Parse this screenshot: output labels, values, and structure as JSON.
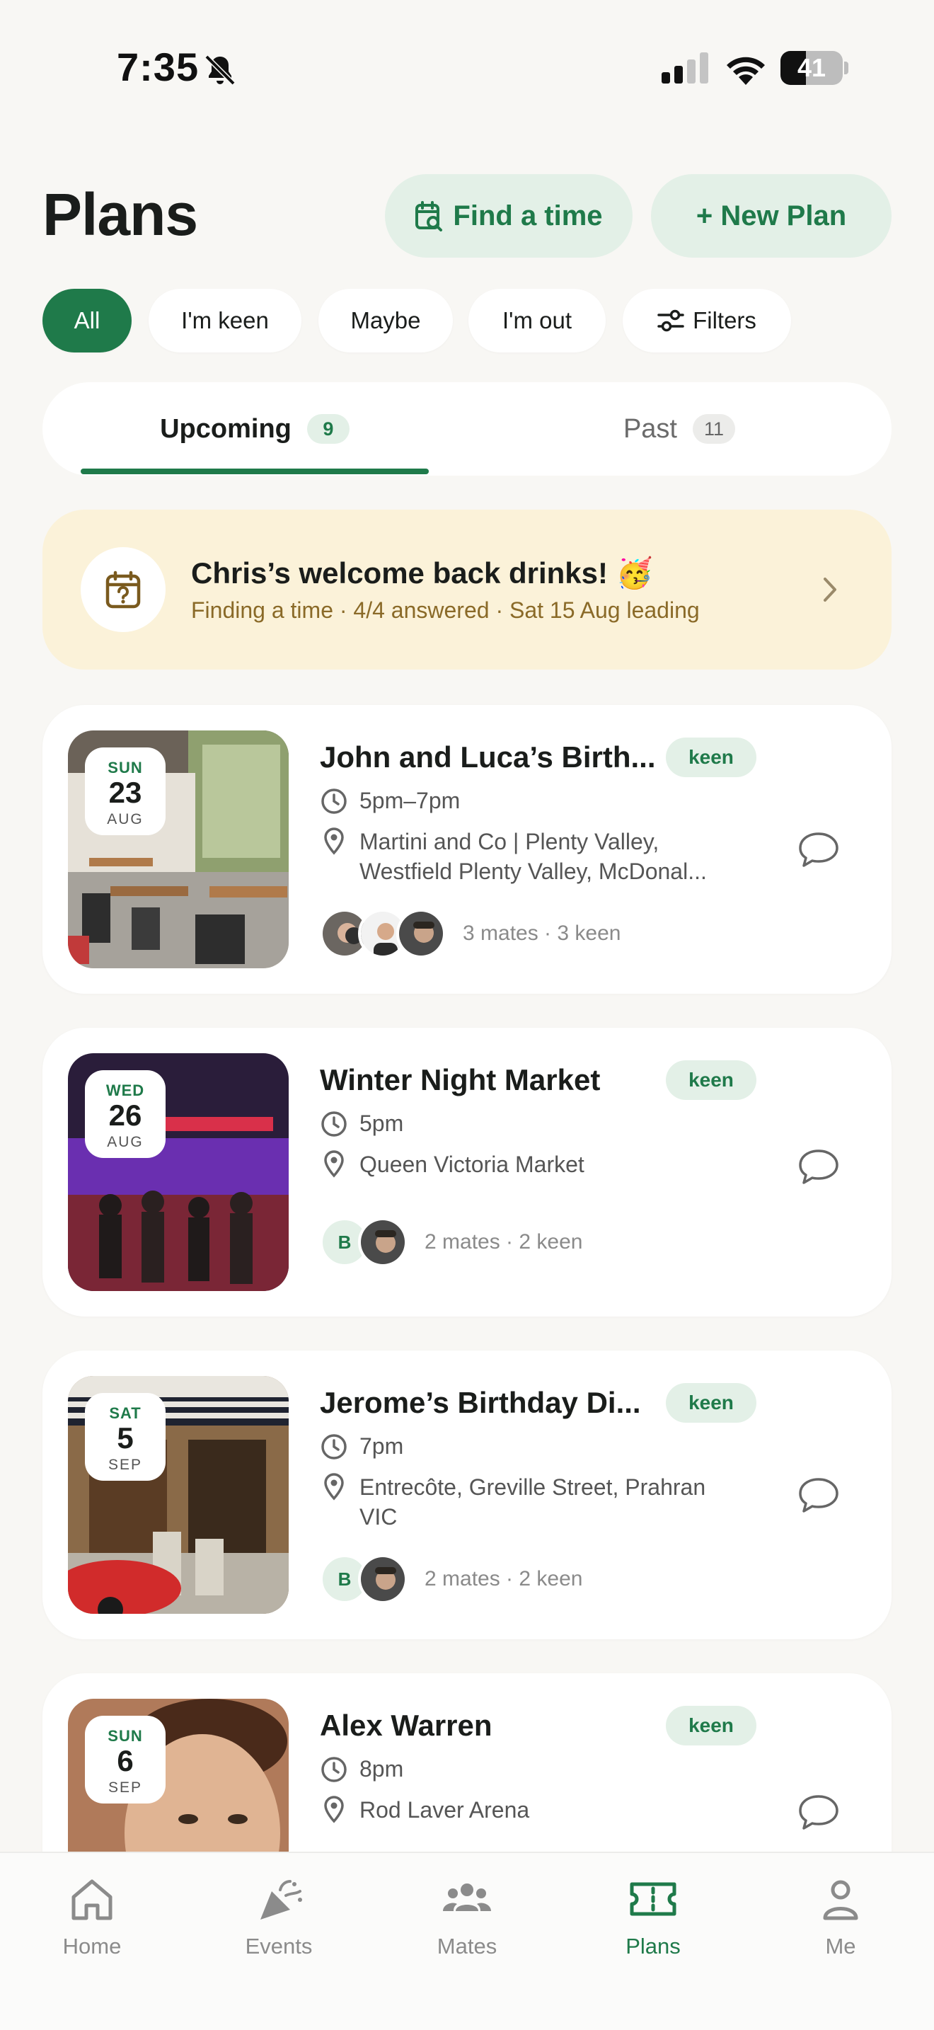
{
  "status": {
    "time": "7:35",
    "battery": "41",
    "battery_level": 0.41
  },
  "header": {
    "title": "Plans",
    "find_time_label": "Find a time",
    "new_plan_label": "+ New Plan"
  },
  "filters": {
    "chips": [
      "All",
      "I'm keen",
      "Maybe",
      "I'm out"
    ],
    "filters_label": "Filters",
    "selected": "All"
  },
  "tabs": {
    "upcoming_label": "Upcoming",
    "upcoming_count": "9",
    "past_label": "Past",
    "past_count": "11",
    "selected": "Upcoming"
  },
  "banner": {
    "title": "Chris’s welcome back drinks! 🥳",
    "subtitle": "Finding a time · 4/4 answered · Sat 15 Aug leading"
  },
  "plans": [
    {
      "dow": "SUN",
      "day": "23",
      "month": "AUG",
      "title": "John and Luca’s Birth...",
      "status": "keen",
      "time": "5pm–7pm",
      "location_line1": "Martini and Co | Plenty Valley,",
      "location_line2": "Westfield Plenty Valley, McDonal...",
      "mates": "3 mates · 3 keen"
    },
    {
      "dow": "WED",
      "day": "26",
      "month": "AUG",
      "title": "Winter Night Market",
      "status": "keen",
      "time": "5pm",
      "location_line1": "Queen Victoria Market",
      "avatar_letter": "B",
      "mates": "2 mates · 2 keen"
    },
    {
      "dow": "SAT",
      "day": "5",
      "month": "SEP",
      "title": "Jerome’s Birthday Di...",
      "status": "keen",
      "time": "7pm",
      "location_line1": "Entrecôte, Greville Street, Prahran",
      "location_line2": "VIC",
      "avatar_letter": "B",
      "mates": "2 mates · 2 keen"
    },
    {
      "dow": "SUN",
      "day": "6",
      "month": "SEP",
      "title": "Alex Warren",
      "status": "keen",
      "time": "8pm",
      "location_line1": "Rod Laver Arena"
    }
  ],
  "nav": {
    "items": [
      {
        "label": "Home",
        "icon": "home-icon"
      },
      {
        "label": "Events",
        "icon": "party-popper-icon"
      },
      {
        "label": "Mates",
        "icon": "people-icon"
      },
      {
        "label": "Plans",
        "icon": "ticket-icon"
      },
      {
        "label": "Me",
        "icon": "person-icon"
      }
    ],
    "active": "Plans"
  },
  "colors": {
    "accent": "#1f7a4a",
    "accent_soft": "#e3f0e7",
    "banner_bg": "#fbf2d9",
    "page_bg": "#f8f7f4"
  }
}
